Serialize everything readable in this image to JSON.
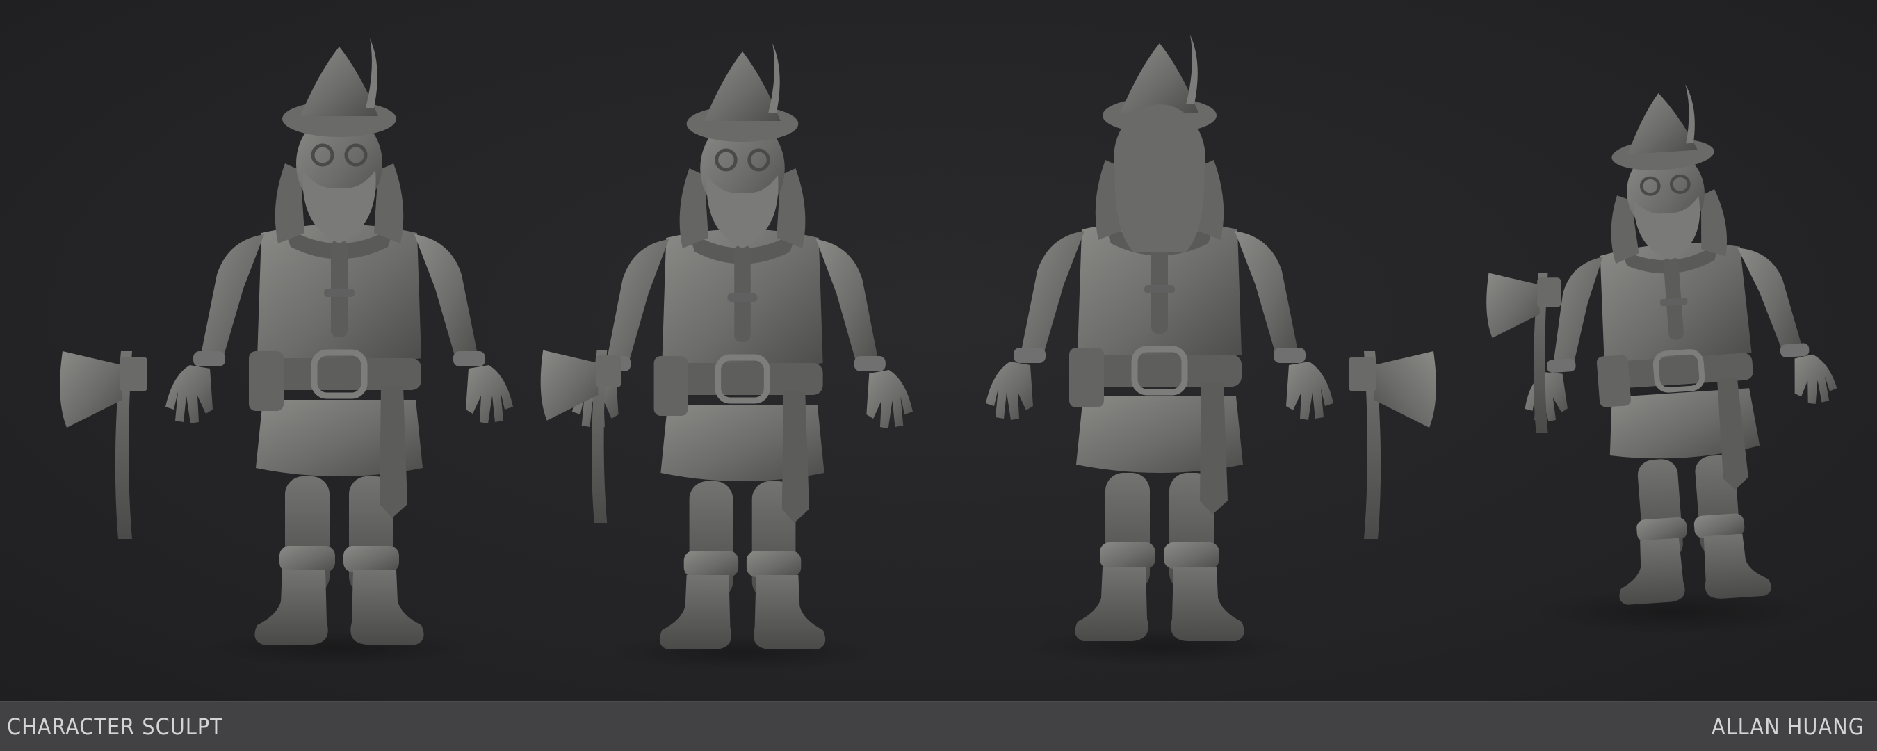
{
  "footer": {
    "title": "CHARACTER SCULPT",
    "author": "ALLAN HUANG"
  },
  "colors": {
    "background": "#242426",
    "footer_bar": "#424244",
    "footer_text": "#d4d4d4",
    "sculpt_clay": "#6e6e6c"
  },
  "views": [
    {
      "name": "front"
    },
    {
      "name": "three-quarter"
    },
    {
      "name": "back"
    },
    {
      "name": "high-angle"
    }
  ]
}
